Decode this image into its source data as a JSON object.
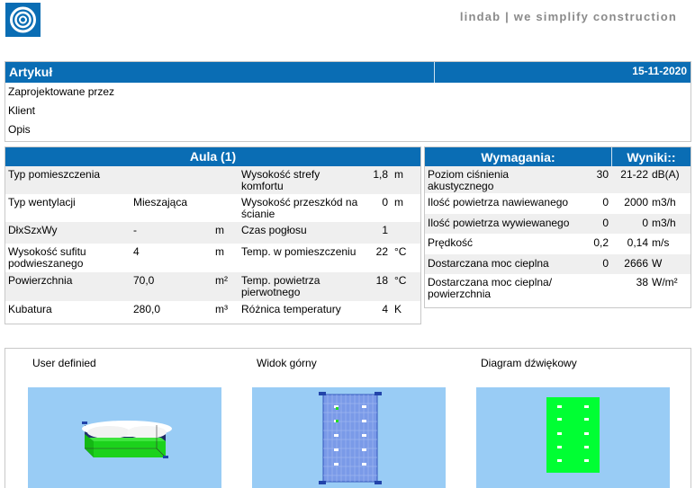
{
  "header": {
    "logo_icon": "lindab-logo-icon",
    "tagline": "lindab  |  we simplify construction"
  },
  "artykul": {
    "title": "Artykuł",
    "date": "15-11-2020",
    "rows": [
      "Zaprojektowane przez",
      "Klient",
      "Opis"
    ]
  },
  "aula": {
    "title": "Aula (1)",
    "rows": [
      {
        "l1": "Typ pomieszczenia",
        "v1": "",
        "u1": "",
        "l2": "Wysokość strefy komfortu",
        "v2": "1,8",
        "u2": "m"
      },
      {
        "l1": "Typ wentylacji",
        "v1": "Mieszająca",
        "u1": "",
        "l2": "Wysokość przeszkód na ścianie",
        "v2": "0",
        "u2": "m"
      },
      {
        "l1": "DłxSzxWy",
        "v1": "-",
        "u1": "m",
        "l2": "Czas pogłosu",
        "v2": "1",
        "u2": ""
      },
      {
        "l1": "Wysokość sufitu podwieszanego",
        "v1": "4",
        "u1": "m",
        "l2": "Temp. w pomieszczeniu",
        "v2": "22",
        "u2": "°C"
      },
      {
        "l1": "Powierzchnia",
        "v1": "70,0",
        "u1": "m²",
        "l2": "Temp. powietrza pierwotnego",
        "v2": "18",
        "u2": "°C"
      },
      {
        "l1": "Kubatura",
        "v1": "280,0",
        "u1": "m³",
        "l2": "Różnica temperatury",
        "v2": "4",
        "u2": "K"
      }
    ]
  },
  "wymagania": {
    "title_left": "Wymagania:",
    "title_right": "Wyniki::",
    "rows": [
      {
        "label": "Poziom ciśnienia akustycznego",
        "req": "30",
        "res": "21-22",
        "unit": "dB(A)",
        "tall": true
      },
      {
        "label": "Ilość powietrza nawiewanego",
        "req": "0",
        "res": "2000",
        "unit": "m3/h",
        "tall": false
      },
      {
        "label": "Ilość powietrza wywiewanego",
        "req": "0",
        "res": "0",
        "unit": "m3/h",
        "tall": false
      },
      {
        "label": "Prędkość",
        "req": "0,2",
        "res": "0,14",
        "unit": "m/s",
        "tall": false
      },
      {
        "label": "Dostarczana moc cieplna",
        "req": "0",
        "res": "2666",
        "unit": "W",
        "tall": false
      },
      {
        "label": "Dostarczana moc cieplna/ powierzchnia",
        "req": "",
        "res": "38",
        "unit": "W/m²",
        "tall": true
      }
    ]
  },
  "views": [
    {
      "label": "User definied",
      "bg": "#99ccf5"
    },
    {
      "label": "Widok górny",
      "bg": "#99ccf5"
    },
    {
      "label": "Diagram dźwiękowy",
      "bg": "#99ccf5"
    }
  ],
  "colors": {
    "accent": "#0a6db4",
    "sound_green": "#00ff33"
  }
}
